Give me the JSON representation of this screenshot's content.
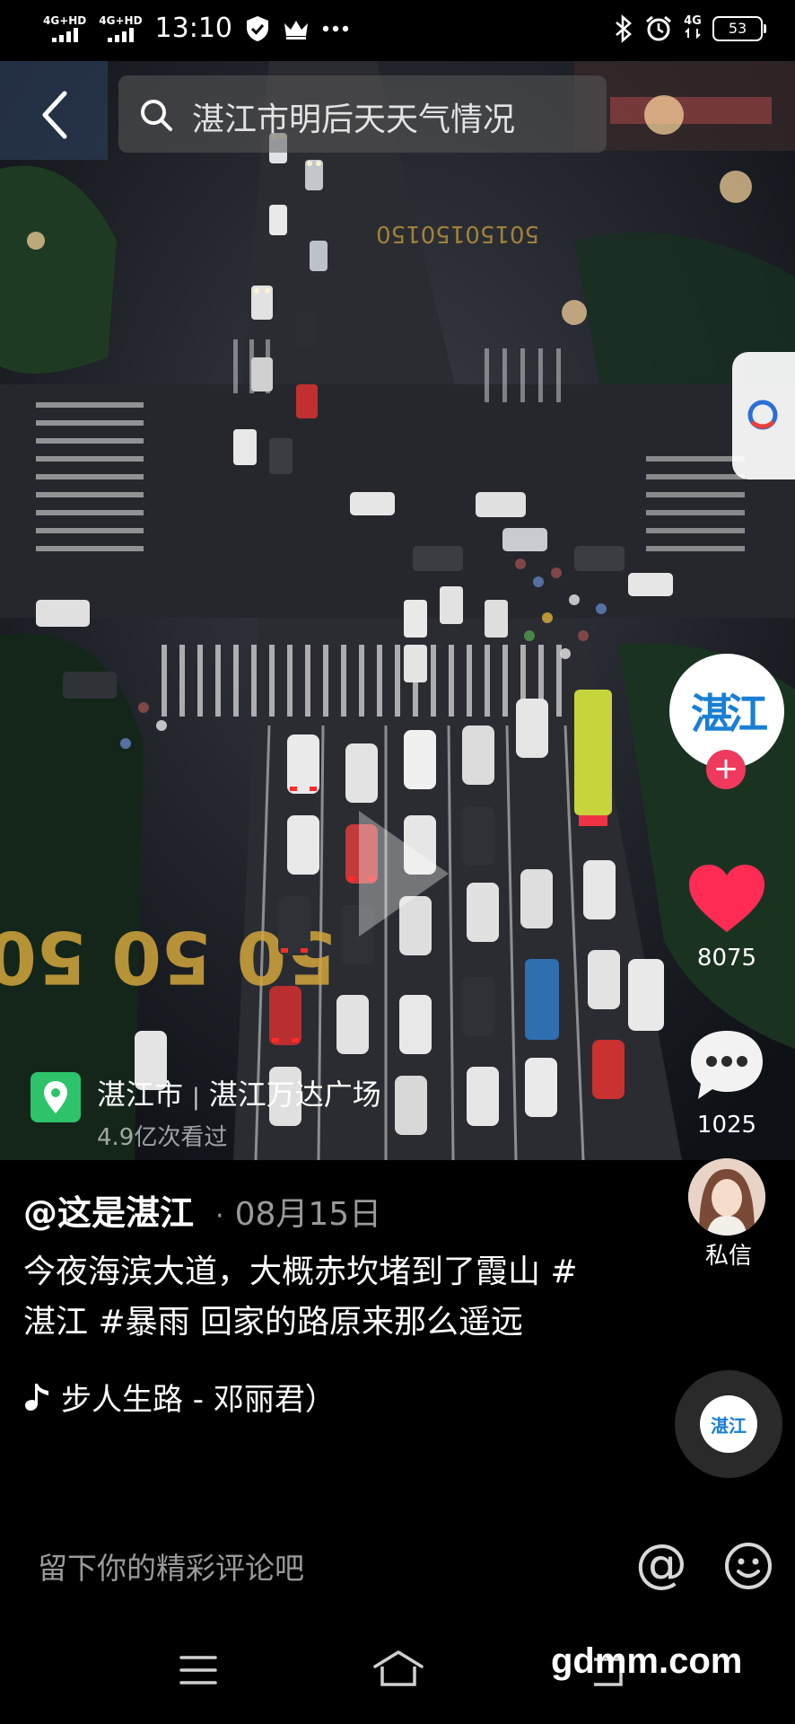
{
  "status_bar": {
    "signal_1": "4G+HD",
    "signal_2": "4G+HD",
    "time": "13:10",
    "network": "4G",
    "battery": "53",
    "icons": [
      "shield-check-icon",
      "crown-icon",
      "more-dots-icon",
      "bluetooth-icon",
      "alarm-icon"
    ]
  },
  "search": {
    "placeholder": "湛江市明后天天气情况"
  },
  "author": {
    "avatar_text": "湛江",
    "handle": "@这是湛江",
    "separator": "·",
    "date": "08月15日"
  },
  "actions": {
    "like_count": "8075",
    "comment_count": "1025",
    "dm_label": "私信"
  },
  "location": {
    "city": "湛江市",
    "separator": "|",
    "place": "湛江万达广场",
    "views": "4.9亿次看过"
  },
  "video": {
    "road_marking_1": "50 50 50",
    "road_marking_2": "50150150150"
  },
  "post": {
    "description": "今夜海滨大道，大概赤坎堵到了霞山 #湛江 #暴雨 回家的路原来那么遥远",
    "music": "步人生路 - 邓丽君）",
    "music_disc_text": "湛江"
  },
  "comment": {
    "placeholder": "留下你的精彩评论吧",
    "at_symbol": "@"
  },
  "watermark": "gdmm.com",
  "colors": {
    "like": "#fe2c55",
    "follow": "#ef3a5d",
    "location": "#2cc36b",
    "brand_blue": "#1a7fd4"
  }
}
